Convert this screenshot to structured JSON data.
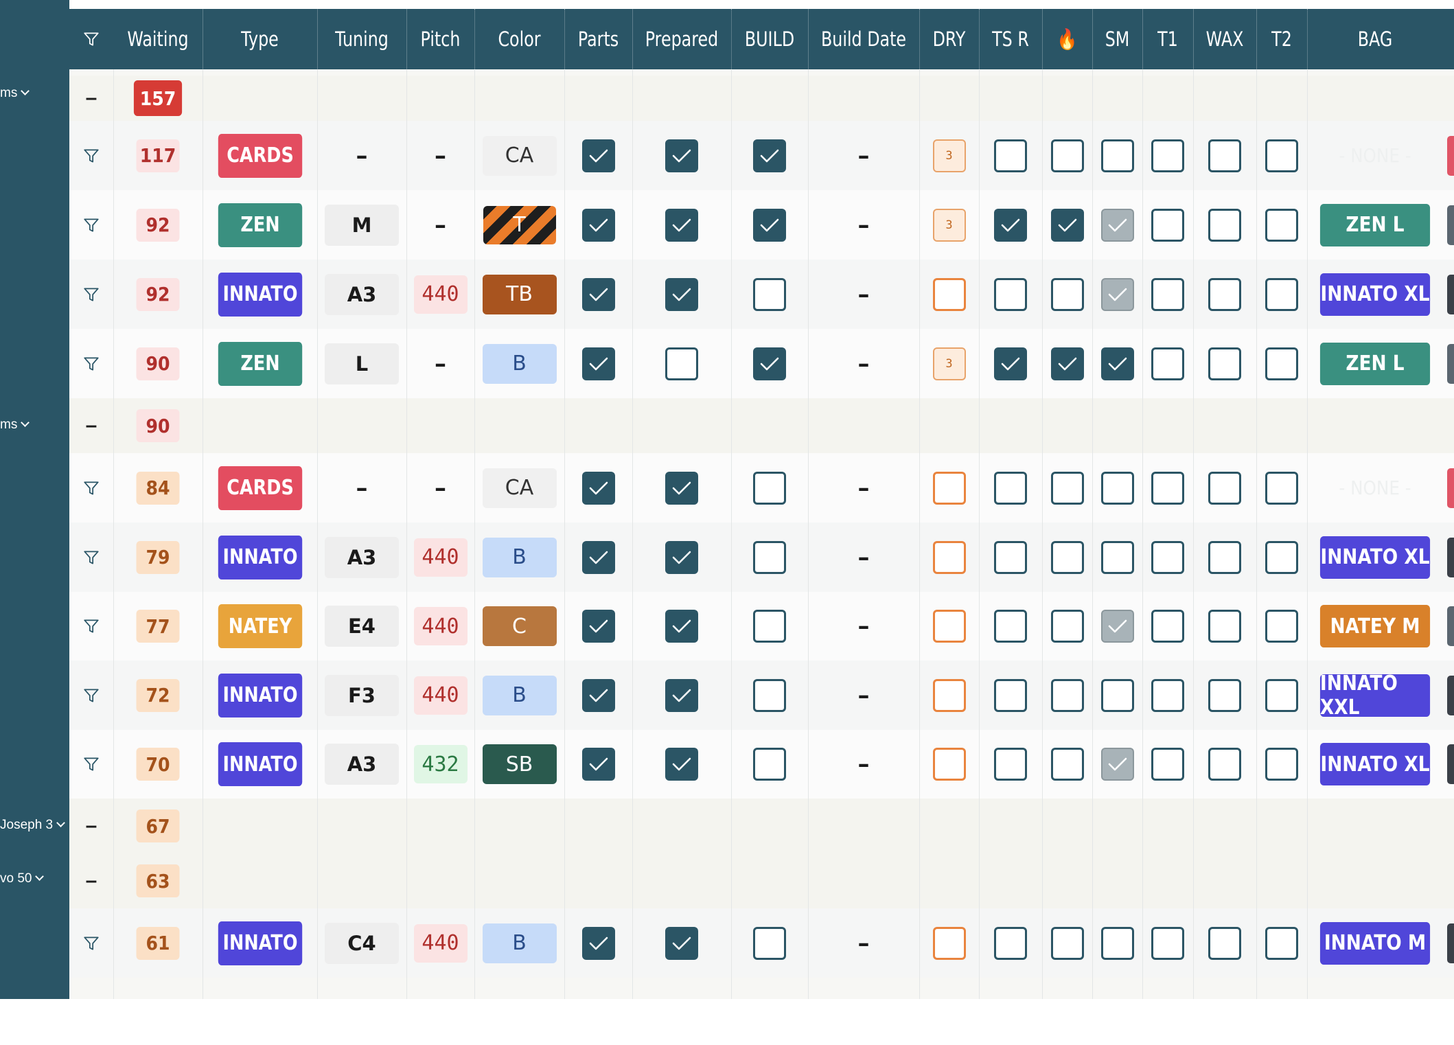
{
  "colors": {
    "header_bg": "#2a5566",
    "sidebar_bg": "#2a5566",
    "group_row_bg": "#f4f4ef",
    "cards": "#e34d60",
    "zen": "#3a9080",
    "innato": "#5046d9",
    "natey": "#e8a43b",
    "natey_bag": "#d9812a",
    "checkbox_on": "#2b5565",
    "dry_orange": "#e9843e"
  },
  "sidebar": {
    "groups": [
      "ms",
      "ms",
      "Joseph 3",
      "vo 50"
    ]
  },
  "header": {
    "filter_icon": "filter-icon",
    "columns": [
      "Waiting",
      "Type",
      "Tuning",
      "Pitch",
      "Color",
      "Parts",
      "Prepared",
      "BUILD",
      "Build Date",
      "DRY",
      "TS R",
      "🔥",
      "SM",
      "T1",
      "WAX",
      "T2",
      "BAG"
    ]
  },
  "rows": [
    {
      "kind": "group",
      "collapse": "–",
      "count": "157"
    },
    {
      "kind": "item",
      "count": "117",
      "type": "CARDS",
      "type_color": "cards",
      "tuning": "–",
      "pitch": "–",
      "pitch_style": "none",
      "color": "CA",
      "color_style": "ca",
      "parts": "on",
      "prepared": "on",
      "build": "on",
      "build_date": "–",
      "dry": "3",
      "tsr": "off",
      "fire": "off",
      "sm": "off",
      "t1": "off",
      "wax": "off",
      "t2": "off",
      "bag": "- NONE -",
      "bag_color": "none",
      "edge": "#e05566"
    },
    {
      "kind": "item",
      "count": "92",
      "type": "ZEN",
      "type_color": "zen",
      "tuning": "M",
      "pitch": "–",
      "pitch_style": "none",
      "color": "T",
      "color_style": "stripe",
      "parts": "on",
      "prepared": "on",
      "build": "on",
      "build_date": "–",
      "dry": "3",
      "tsr": "on",
      "fire": "on",
      "sm": "gray",
      "t1": "off",
      "wax": "off",
      "t2": "off",
      "bag": "ZEN L",
      "bag_color": "zen",
      "edge": "#5b6670"
    },
    {
      "kind": "item",
      "count": "92",
      "type": "INNATO",
      "type_color": "innato",
      "tuning": "A3",
      "pitch": "440",
      "pitch_style": "red",
      "color": "TB",
      "color_style": "tb",
      "parts": "on",
      "prepared": "on",
      "build": "off",
      "build_date": "–",
      "dry": "",
      "tsr": "off",
      "fire": "off",
      "sm": "gray",
      "t1": "off",
      "wax": "off",
      "t2": "off",
      "bag": "INNATO XL",
      "bag_color": "innato",
      "edge": "#3b4048"
    },
    {
      "kind": "item",
      "count": "90",
      "type": "ZEN",
      "type_color": "zen",
      "tuning": "L",
      "pitch": "–",
      "pitch_style": "none",
      "color": "B",
      "color_style": "b",
      "parts": "on",
      "prepared": "off",
      "build": "on",
      "build_date": "–",
      "dry": "3",
      "tsr": "on",
      "fire": "on",
      "sm": "on",
      "t1": "off",
      "wax": "off",
      "t2": "off",
      "bag": "ZEN L",
      "bag_color": "zen",
      "edge": "#5b6670"
    },
    {
      "kind": "group",
      "collapse": "–",
      "count": "90"
    },
    {
      "kind": "item",
      "count": "84",
      "type": "CARDS",
      "type_color": "cards",
      "tuning": "–",
      "pitch": "–",
      "pitch_style": "none",
      "color": "CA",
      "color_style": "ca",
      "parts": "on",
      "prepared": "on",
      "build": "off",
      "build_date": "–",
      "dry": "",
      "tsr": "off",
      "fire": "off",
      "sm": "off",
      "t1": "off",
      "wax": "off",
      "t2": "off",
      "bag": "- NONE -",
      "bag_color": "none",
      "edge": "#e05566"
    },
    {
      "kind": "item",
      "count": "79",
      "type": "INNATO",
      "type_color": "innato",
      "tuning": "A3",
      "pitch": "440",
      "pitch_style": "red",
      "color": "B",
      "color_style": "b",
      "parts": "on",
      "prepared": "on",
      "build": "off",
      "build_date": "–",
      "dry": "",
      "tsr": "off",
      "fire": "off",
      "sm": "off",
      "t1": "off",
      "wax": "off",
      "t2": "off",
      "bag": "INNATO XL",
      "bag_color": "innato",
      "edge": "#3b4048"
    },
    {
      "kind": "item",
      "count": "77",
      "type": "NATEY",
      "type_color": "natey",
      "tuning": "E4",
      "pitch": "440",
      "pitch_style": "red",
      "color": "C",
      "color_style": "c",
      "parts": "on",
      "prepared": "on",
      "build": "off",
      "build_date": "–",
      "dry": "",
      "tsr": "off",
      "fire": "off",
      "sm": "gray",
      "t1": "off",
      "wax": "off",
      "t2": "off",
      "bag": "NATEY M",
      "bag_color": "natey_bag",
      "edge": "#5b6670"
    },
    {
      "kind": "item",
      "count": "72",
      "type": "INNATO",
      "type_color": "innato",
      "tuning": "F3",
      "pitch": "440",
      "pitch_style": "red",
      "color": "B",
      "color_style": "b",
      "parts": "on",
      "prepared": "on",
      "build": "off",
      "build_date": "–",
      "dry": "",
      "tsr": "off",
      "fire": "off",
      "sm": "off",
      "t1": "off",
      "wax": "off",
      "t2": "off",
      "bag": "INNATO XXL",
      "bag_color": "innato",
      "edge": "#3b4048"
    },
    {
      "kind": "item",
      "count": "70",
      "type": "INNATO",
      "type_color": "innato",
      "tuning": "A3",
      "pitch": "432",
      "pitch_style": "green",
      "color": "SB",
      "color_style": "sb",
      "parts": "on",
      "prepared": "on",
      "build": "off",
      "build_date": "–",
      "dry": "",
      "tsr": "off",
      "fire": "off",
      "sm": "gray",
      "t1": "off",
      "wax": "off",
      "t2": "off",
      "bag": "INNATO XL",
      "bag_color": "innato",
      "edge": "#3b4048"
    },
    {
      "kind": "group",
      "collapse": "–",
      "count": "67"
    },
    {
      "kind": "group",
      "collapse": "–",
      "count": "63"
    },
    {
      "kind": "item",
      "count": "61",
      "type": "INNATO",
      "type_color": "innato",
      "tuning": "C4",
      "pitch": "440",
      "pitch_style": "red",
      "color": "B",
      "color_style": "b",
      "parts": "on",
      "prepared": "on",
      "build": "off",
      "build_date": "–",
      "dry": "",
      "tsr": "off",
      "fire": "off",
      "sm": "off",
      "t1": "off",
      "wax": "off",
      "t2": "off",
      "bag": "INNATO M",
      "bag_color": "innato",
      "edge": "#3b4048"
    }
  ]
}
